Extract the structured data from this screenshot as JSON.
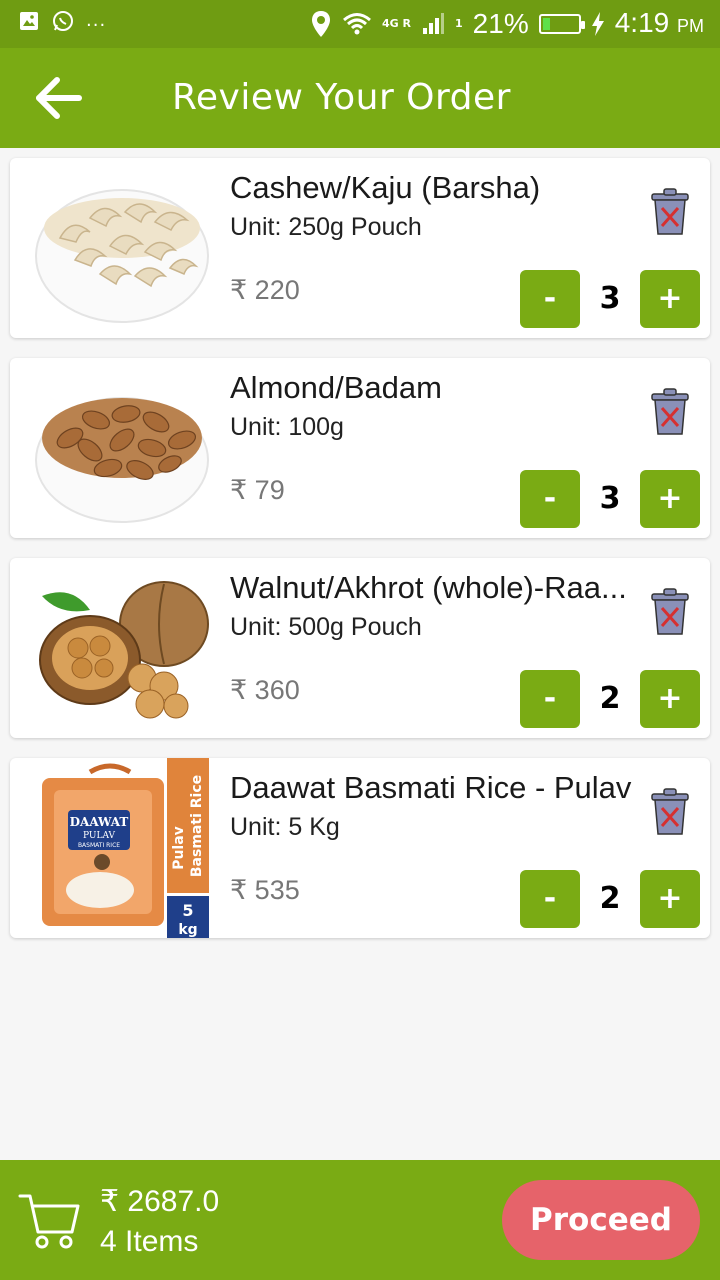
{
  "status_bar": {
    "icons": [
      "image-icon",
      "whatsapp-icon",
      "more-dots-icon",
      "location-icon",
      "wifi-icon",
      "signal-icon",
      "battery-icon",
      "charging-icon"
    ],
    "dots": "...",
    "network_label": "4G R",
    "sim_number": "1",
    "battery_percent": "21%",
    "time": "4:19",
    "ampm": "PM",
    "colors": {
      "background": "#6f9c12",
      "battery_fill": "#5fe04a"
    }
  },
  "app_bar": {
    "title": "Review Your Order",
    "back_icon": "arrow-left-icon",
    "color": "#7aab14"
  },
  "items": [
    {
      "name": "Cashew/Kaju (Barsha)",
      "unit": "Unit: 250g Pouch",
      "price": "₹ 220",
      "qty": "3",
      "minus_label": "-",
      "plus_label": "+",
      "image": "cashew-bowl-image"
    },
    {
      "name": "Almond/Badam",
      "unit": "Unit: 100g",
      "price": "₹ 79",
      "qty": "3",
      "minus_label": "-",
      "plus_label": "+",
      "image": "almond-bowl-image"
    },
    {
      "name": "Walnut/Akhrot (whole)-Raa...",
      "unit": "Unit: 500g Pouch",
      "price": "₹ 360",
      "qty": "2",
      "minus_label": "-",
      "plus_label": "+",
      "image": "walnut-image"
    },
    {
      "name": "Daawat Basmati Rice - Pulav",
      "unit": "Unit: 5 Kg",
      "price": "₹ 535",
      "qty": "2",
      "minus_label": "-",
      "plus_label": "+",
      "image": "rice-bag-image",
      "package_text": {
        "brand": "DAAWAT",
        "variant": "PULAV",
        "subtitle": "BASMATI RICE",
        "side_label_1": "Pulav",
        "side_label_2": "Basmati Rice",
        "weight_number": "5",
        "weight_unit": "kg"
      }
    }
  ],
  "bottom_bar": {
    "total": "₹ 2687.0",
    "count": "4 Items",
    "proceed_label": "Proceed",
    "cart_icon": "cart-icon",
    "proceed_color": "#e6636a"
  }
}
